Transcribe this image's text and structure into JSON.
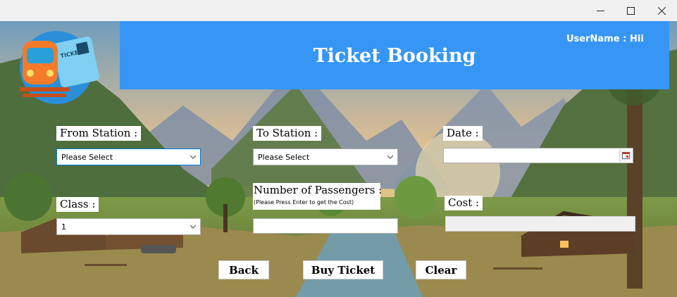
{
  "window": {
    "controls": {
      "minimize_icon": "minimize-icon",
      "maximize_icon": "maximize-icon",
      "close_icon": "close-icon"
    }
  },
  "header": {
    "title": "Ticket Booking",
    "username_label": "UserName :",
    "username_value": "Hii",
    "background_color": "#3796f5"
  },
  "logo": {
    "icon": "train-ticket-logo",
    "ticket_text": "TICKET"
  },
  "form": {
    "from_station": {
      "label": "From Station :",
      "value": "Please Select"
    },
    "to_station": {
      "label": "To Station :",
      "value": "Please Select"
    },
    "date": {
      "label": "Date :",
      "value": "",
      "icon": "calendar-icon"
    },
    "class": {
      "label": "Class :",
      "value": "1"
    },
    "passengers": {
      "label": "Number of Passengers :",
      "hint": "(Please Press Enter to get the Cost)",
      "value": ""
    },
    "cost": {
      "label": "Cost :",
      "value": ""
    }
  },
  "buttons": {
    "back": "Back",
    "buy": "Buy Ticket",
    "clear": "Clear"
  }
}
